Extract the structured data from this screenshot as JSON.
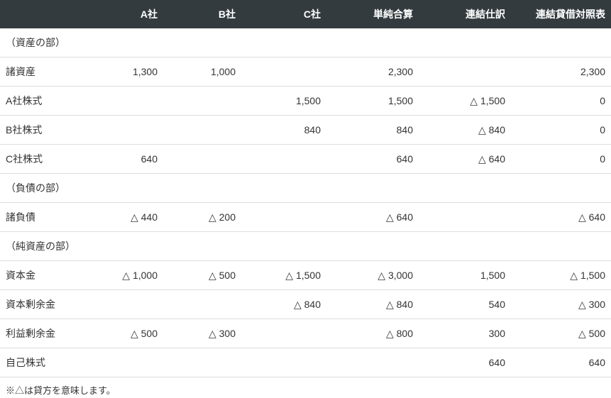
{
  "columns": [
    "",
    "A社",
    "B社",
    "C社",
    "単純合算",
    "連結仕訳",
    "連結貸借対照表"
  ],
  "sections": {
    "assets": "（資産の部）",
    "liabilities": "（負債の部）",
    "equity": "（純資産の部）"
  },
  "rows": {
    "assets_items": [
      {
        "label": "諸資産",
        "a": "1,300",
        "b": "1,000",
        "c": "",
        "sum": "2,300",
        "adj": "",
        "cons": "2,300"
      },
      {
        "label": "A社株式",
        "a": "",
        "b": "",
        "c": "1,500",
        "sum": "1,500",
        "adj": "△ 1,500",
        "cons": "0"
      },
      {
        "label": "B社株式",
        "a": "",
        "b": "",
        "c": "840",
        "sum": "840",
        "adj": "△ 840",
        "cons": "0"
      },
      {
        "label": "C社株式",
        "a": "640",
        "b": "",
        "c": "",
        "sum": "640",
        "adj": "△ 640",
        "cons": "0"
      }
    ],
    "liabilities_items": [
      {
        "label": "諸負債",
        "a": "△ 440",
        "b": "△ 200",
        "c": "",
        "sum": "△ 640",
        "adj": "",
        "cons": "△ 640"
      }
    ],
    "equity_items": [
      {
        "label": "資本金",
        "a": "△ 1,000",
        "b": "△ 500",
        "c": "△ 1,500",
        "sum": "△ 3,000",
        "adj": "1,500",
        "cons": "△ 1,500"
      },
      {
        "label": "資本剰余金",
        "a": "",
        "b": "",
        "c": "△ 840",
        "sum": "△ 840",
        "adj": "540",
        "cons": "△ 300"
      },
      {
        "label": "利益剰余金",
        "a": "△ 500",
        "b": "△ 300",
        "c": "",
        "sum": "△ 800",
        "adj": "300",
        "cons": "△ 500"
      },
      {
        "label": "自己株式",
        "a": "",
        "b": "",
        "c": "",
        "sum": "",
        "adj": "640",
        "cons": "640"
      }
    ]
  },
  "footnote": "※△は貸方を意味します。"
}
